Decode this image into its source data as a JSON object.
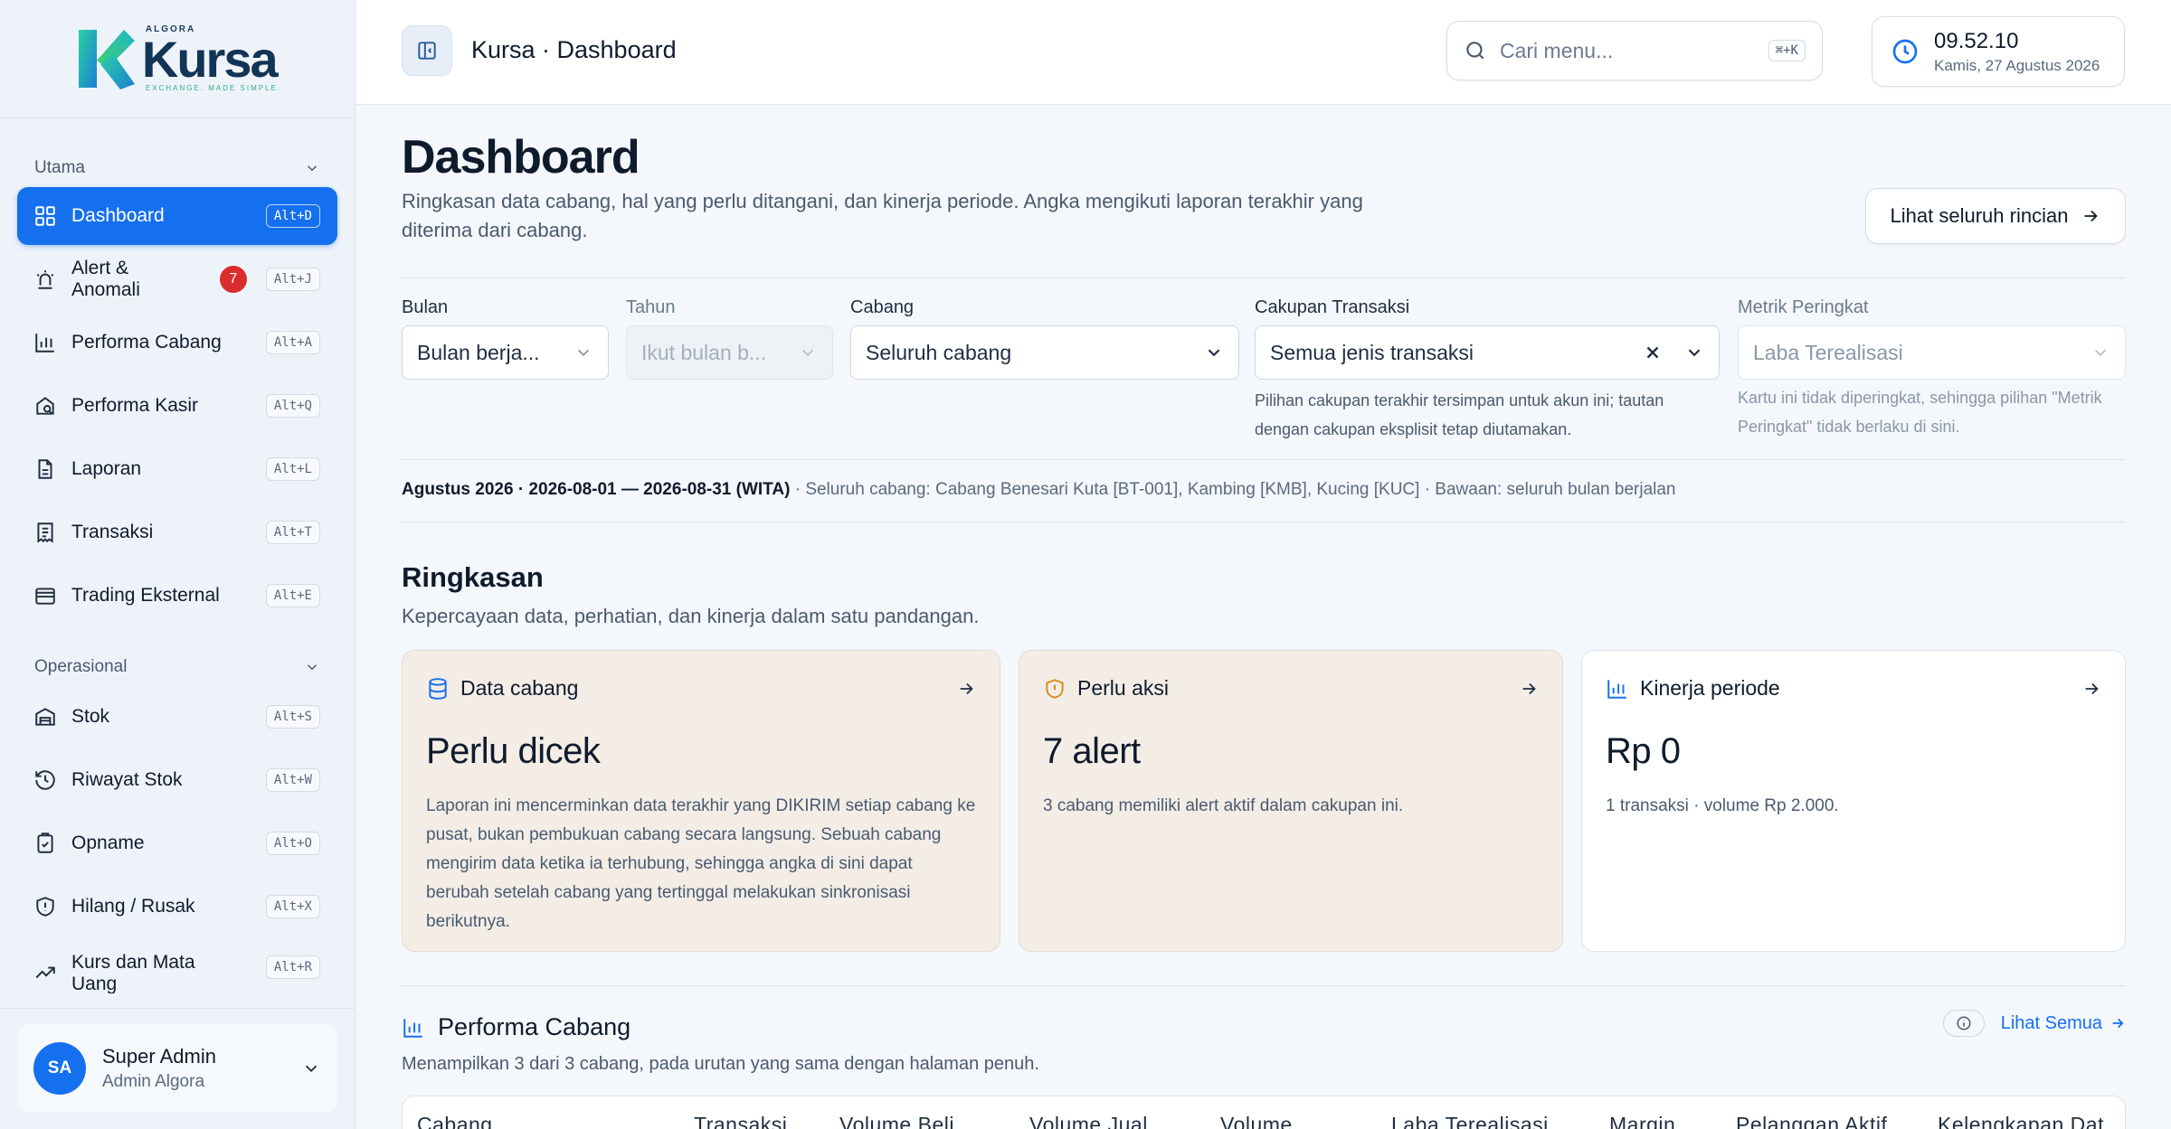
{
  "app": {
    "logo_small": "ALGORA",
    "logo_name": "Kursa",
    "logo_tagline": "EXCHANGE. MADE SIMPLE."
  },
  "sidebar": {
    "section_main": "Utama",
    "section_ops": "Operasional",
    "main_items": [
      {
        "label": "Dashboard",
        "shortcut": "Alt+D"
      },
      {
        "label": "Alert & Anomali",
        "shortcut": "Alt+J",
        "badge": "7"
      },
      {
        "label": "Performa Cabang",
        "shortcut": "Alt+A"
      },
      {
        "label": "Performa Kasir",
        "shortcut": "Alt+Q"
      },
      {
        "label": "Laporan",
        "shortcut": "Alt+L"
      },
      {
        "label": "Transaksi",
        "shortcut": "Alt+T"
      },
      {
        "label": "Trading Eksternal",
        "shortcut": "Alt+E"
      }
    ],
    "ops_items": [
      {
        "label": "Stok",
        "shortcut": "Alt+S"
      },
      {
        "label": "Riwayat Stok",
        "shortcut": "Alt+W"
      },
      {
        "label": "Opname",
        "shortcut": "Alt+O"
      },
      {
        "label": "Hilang / Rusak",
        "shortcut": "Alt+X"
      },
      {
        "label": "Kurs dan Mata Uang",
        "shortcut": "Alt+R"
      }
    ],
    "user": {
      "initials": "SA",
      "name": "Super Admin",
      "role": "Admin Algora"
    }
  },
  "topbar": {
    "breadcrumb": "Kursa · Dashboard",
    "search_placeholder": "Cari menu...",
    "search_shortcut": "⌘+K",
    "time": "09.52.10",
    "date": "Kamis, 27 Agustus 2026"
  },
  "page": {
    "title": "Dashboard",
    "subtitle": "Ringkasan data cabang, hal yang perlu ditangani, dan kinerja periode. Angka mengikuti laporan terakhir yang diterima dari cabang.",
    "detail_button": "Lihat seluruh rincian"
  },
  "filters": {
    "month": {
      "label": "Bulan",
      "value": "Bulan berja..."
    },
    "year": {
      "label": "Tahun",
      "value": "Ikut bulan b..."
    },
    "branch": {
      "label": "Cabang",
      "value": "Seluruh cabang"
    },
    "scope": {
      "label": "Cakupan Transaksi",
      "value": "Semua jenis transaksi",
      "hint": "Pilihan cakupan terakhir tersimpan untuk akun ini; tautan dengan cakupan eksplisit tetap diutamakan."
    },
    "rank": {
      "label": "Metrik Peringkat",
      "value": "Laba Terealisasi",
      "hint": "Kartu ini tidak diperingkat, sehingga pilihan \"Metrik Peringkat\" tidak berlaku di sini."
    }
  },
  "period": {
    "main": "Agustus 2026 · 2026-08-01 — 2026-08-31 (WITA)",
    "rest": " · Seluruh cabang: Cabang Benesari Kuta [BT-001], Kambing [KMB], Kucing [KUC] · Bawaan: seluruh bulan berjalan"
  },
  "summary": {
    "title": "Ringkasan",
    "subtitle": "Kepercayaan data, perhatian, dan kinerja dalam satu pandangan.",
    "cards": [
      {
        "title": "Data cabang",
        "value": "Perlu dicek",
        "text": "Laporan ini mencerminkan data terakhir yang DIKIRIM setiap cabang ke pusat, bukan pembukuan cabang secara langsung. Sebuah cabang mengirim data ketika ia terhubung, sehingga angka di sini dapat berubah setelah cabang yang tertinggal melakukan sinkronisasi berikutnya."
      },
      {
        "title": "Perlu aksi",
        "value": "7 alert",
        "text": "3 cabang memiliki alert aktif dalam cakupan ini."
      },
      {
        "title": "Kinerja periode",
        "value": "Rp 0",
        "text": "1 transaksi · volume Rp 2.000."
      }
    ]
  },
  "branch_perf": {
    "title": "Performa Cabang",
    "subtitle": "Menampilkan 3 dari 3 cabang, pada urutan yang sama dengan halaman penuh.",
    "see_all": "Lihat Semua",
    "columns": [
      "Cabang",
      "Transaksi",
      "Volume Beli",
      "Volume Jual",
      "Volume",
      "Laba Terealisasi",
      "Margin",
      "Pelanggan Aktif",
      "Kelengkapan Dat"
    ]
  },
  "colors": {
    "accent": "#1570ef",
    "badge": "#d92d2d",
    "warn_card": "#f3ede6",
    "warn_icon": "#d98a1a"
  }
}
